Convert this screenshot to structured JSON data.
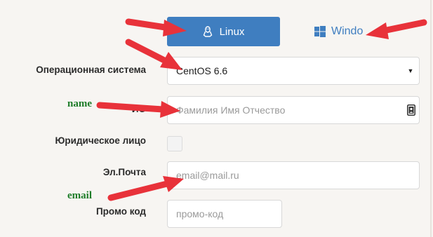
{
  "os_tabs": {
    "linux_label": "Linux",
    "windows_label": "Windo"
  },
  "form": {
    "os_label": "Операционная система",
    "os_value": "CentOS 6.6",
    "fio_label_partial": "ИО",
    "fio_placeholder": "Фамилия Имя Отчество",
    "legal_entity_label": "Юридическое лицо",
    "email_label": "Эл.Почта",
    "email_placeholder": "email@mail.ru",
    "promo_label": "Промо код",
    "promo_placeholder": "промо-код"
  },
  "annotations": {
    "name": "name",
    "email": "email"
  },
  "colors": {
    "accent": "#3f7ec0",
    "arrow": "#e8323a",
    "annotation_text": "#1e7d2a"
  }
}
